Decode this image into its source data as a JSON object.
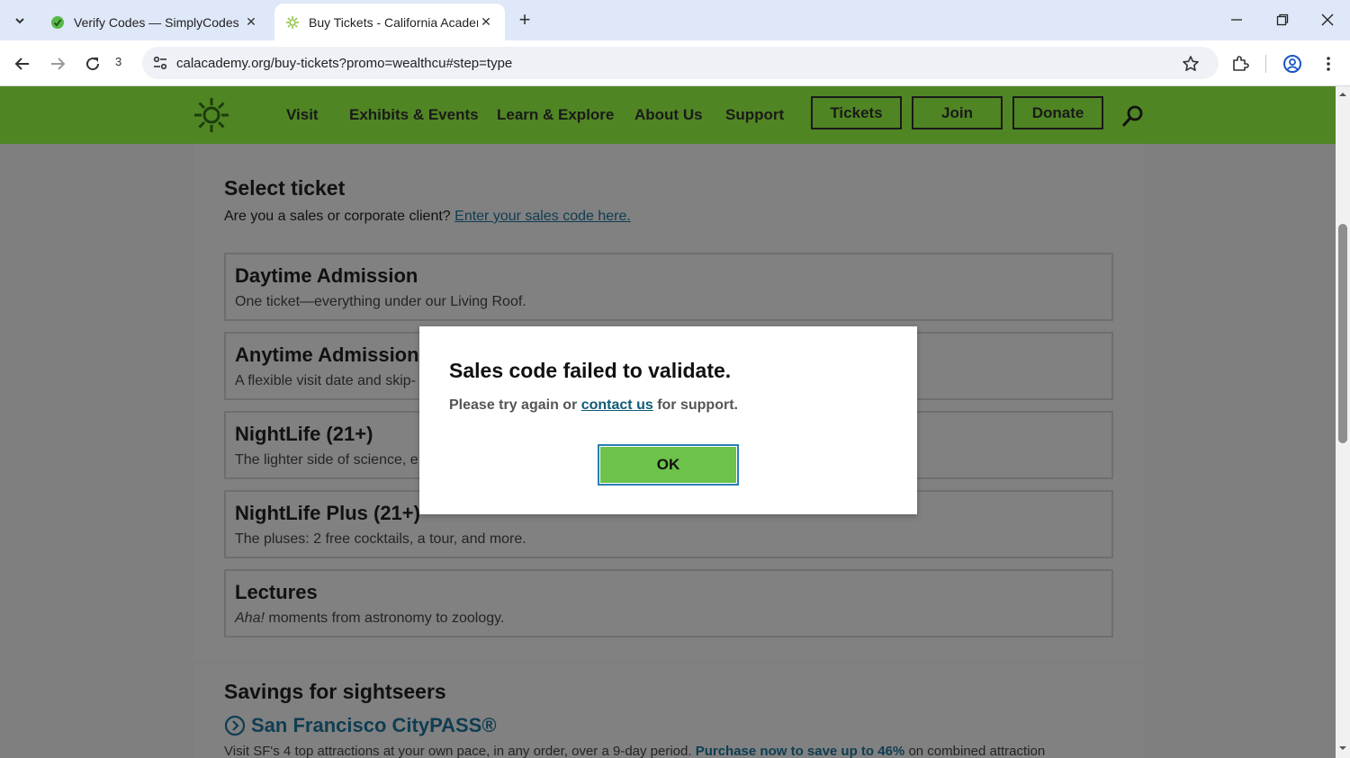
{
  "browser": {
    "tabs": [
      {
        "title": "Verify Codes — SimplyCodes",
        "active": false
      },
      {
        "title": "Buy Tickets - California Academ",
        "active": true
      }
    ],
    "reload_count": "3",
    "url": "calacademy.org/buy-tickets?promo=wealthcu#step=type"
  },
  "site_nav": {
    "links": [
      "Visit",
      "Exhibits & Events",
      "Learn & Explore",
      "About Us",
      "Support"
    ],
    "buttons": [
      "Tickets",
      "Join",
      "Donate"
    ]
  },
  "select_ticket": {
    "heading": "Select ticket",
    "sales_prompt": "Are you a sales or corporate client?",
    "sales_link": "Enter your sales code here.",
    "tickets": [
      {
        "name": "Daytime Admission",
        "desc": "One ticket—everything under our Living Roof."
      },
      {
        "name": "Anytime Admission",
        "desc": "A flexible visit date and skip-"
      },
      {
        "name": "NightLife (21+)",
        "desc": "The lighter side of science, e"
      },
      {
        "name": "NightLife Plus (21+)",
        "desc": "The pluses: 2 free cocktails, a tour, and more."
      },
      {
        "name": "Lectures",
        "desc_italic": "Aha!",
        "desc": " moments from astronomy to zoology."
      }
    ]
  },
  "savings": {
    "heading": "Savings for sightseers",
    "citypass_title": "San Francisco CityPASS®",
    "citypass_desc_start": "Visit SF's 4 top attractions at your own pace, in any order, over a 9-day period.",
    "citypass_desc_bold": "Purchase now to save up to 46%",
    "citypass_desc_end": " on combined attraction"
  },
  "modal": {
    "title": "Sales code failed to validate.",
    "msg_before": "Please try again or ",
    "msg_link": "contact us",
    "msg_after": " for support.",
    "ok_label": "OK"
  },
  "colors": {
    "header_green": "#508523",
    "ok_green": "#6cc24a",
    "link_blue": "#0f3d52"
  }
}
